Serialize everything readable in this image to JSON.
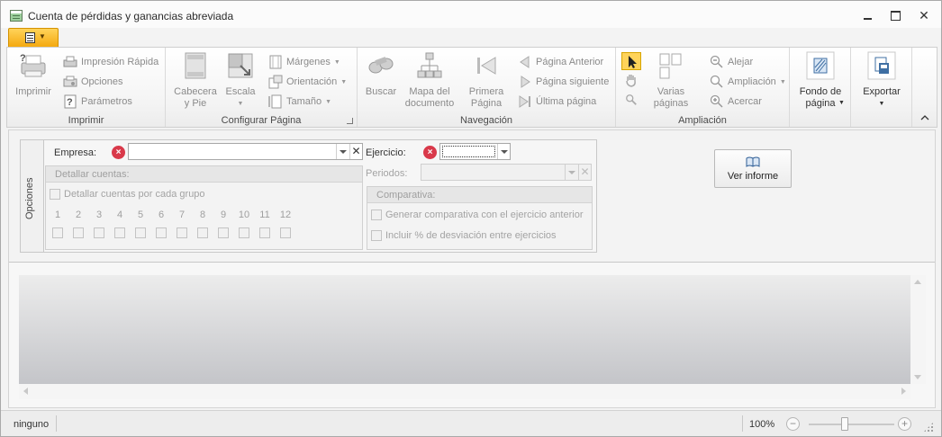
{
  "window": {
    "title": "Cuenta de pérdidas y ganancias abreviada",
    "minimize_icon": "window-minimize-icon",
    "maximize_icon": "window-maximize-icon",
    "close_label": "✕"
  },
  "ribbon": {
    "groups": {
      "imprimir": {
        "label": "Imprimir",
        "big": "Imprimir",
        "items": [
          "Impresión Rápida",
          "Opciones",
          "Parámetros"
        ]
      },
      "configurar": {
        "label": "Configurar Página",
        "big": [
          "Cabecera\ny Pie",
          "Escala"
        ],
        "items": [
          "Márgenes",
          "Orientación",
          "Tamaño"
        ]
      },
      "navegacion": {
        "label": "Navegación",
        "big": [
          "Buscar",
          "Mapa del\ndocumento",
          "Primera\nPágina"
        ],
        "items": [
          "Página Anterior",
          "Página siguiente",
          "Última página"
        ]
      },
      "ampliacion": {
        "label": "Ampliación",
        "big": "Varias\npáginas",
        "items": [
          "Alejar",
          "Ampliación",
          "Acercar"
        ]
      },
      "fondo": {
        "label": "Fondo de\npágina"
      },
      "exportar": {
        "label": "Exportar"
      }
    }
  },
  "options": {
    "tab_label": "Opciones",
    "empresa_label": "Empresa:",
    "empresa_value": "",
    "ejercicio_label": "Ejercicio:",
    "ejercicio_value": "",
    "periodos_label": "Periodos:",
    "detallar": {
      "title": "Detallar cuentas:",
      "checkbox": "Detallar cuentas por cada grupo",
      "months": [
        "1",
        "2",
        "3",
        "4",
        "5",
        "6",
        "7",
        "8",
        "9",
        "10",
        "11",
        "12"
      ]
    },
    "comparativa": {
      "title": "Comparativa:",
      "checkbox1": "Generar comparativa con el ejercicio anterior",
      "checkbox2": "Incluir % de desviación entre ejercicios"
    },
    "ver_informe": "Ver informe"
  },
  "status": {
    "text": "ninguno",
    "zoom": "100%",
    "zoom_level": 100
  },
  "colors": {
    "app_button": "#f4a910",
    "error": "#d9394a",
    "active_tool": "#ffd35a"
  }
}
